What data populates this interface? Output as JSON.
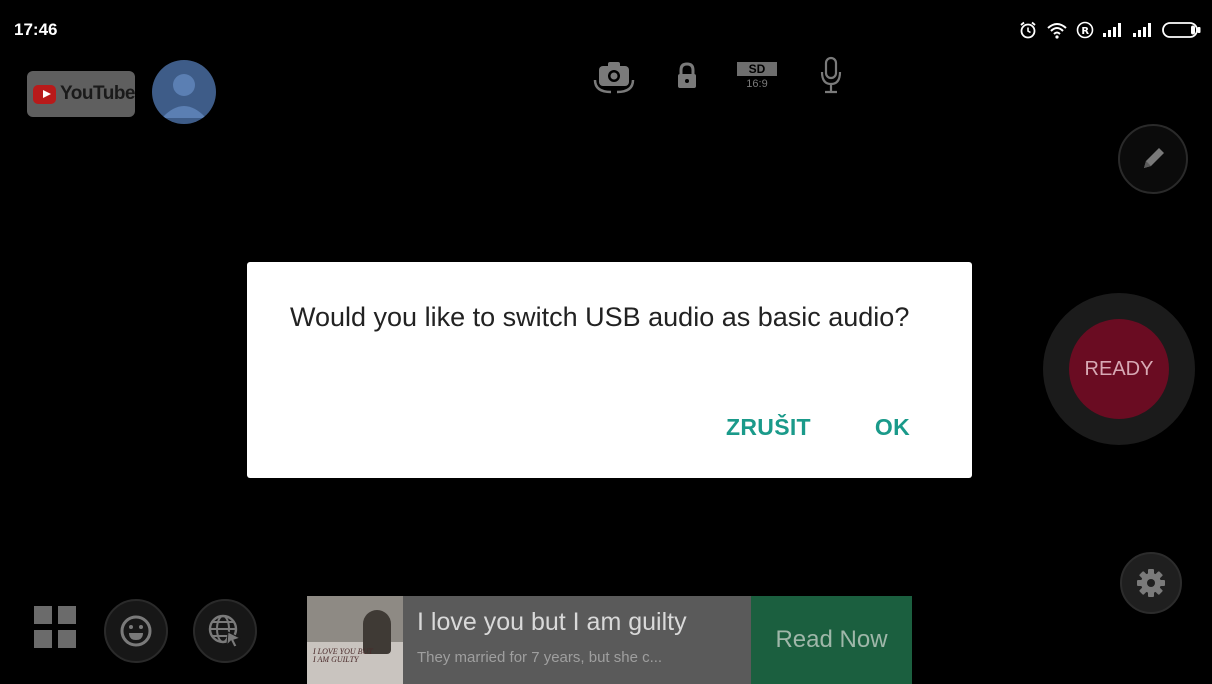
{
  "status_bar": {
    "time": "17:46",
    "icons": [
      "alarm-icon",
      "wifi-icon",
      "roaming-icon",
      "signal-icon",
      "signal-icon",
      "battery-icon"
    ]
  },
  "top_left": {
    "platform_logo_text": "YouTube",
    "avatar_icon": "account-icon"
  },
  "toolbar": {
    "camera_switch_icon": "camera-switch-icon",
    "lock_icon": "lock-icon",
    "quality_top": "SD",
    "quality_bottom": "16:9",
    "mic_icon": "microphone-icon"
  },
  "right_controls": {
    "edit_icon": "pencil-icon",
    "record_label": "READY",
    "settings_icon": "gear-icon"
  },
  "bottom_controls": {
    "grid_icon": "grid-icon",
    "emoji_icon": "emoji-icon",
    "web_icon": "globe-cursor-icon"
  },
  "ad": {
    "thumb_text": "I LOVE YOU BUT I AM GUILTY",
    "title": "I love you but I am guilty",
    "description": "They married for 7 years, but she c...",
    "cta": "Read Now"
  },
  "dialog": {
    "message": "Would you like to switch USB audio as basic audio?",
    "cancel_label": "ZRUŠIT",
    "ok_label": "OK"
  },
  "colors": {
    "dialog_button": "#1a9a8a",
    "record": "#6a0c22",
    "ad_cta": "#1b5f3f"
  }
}
